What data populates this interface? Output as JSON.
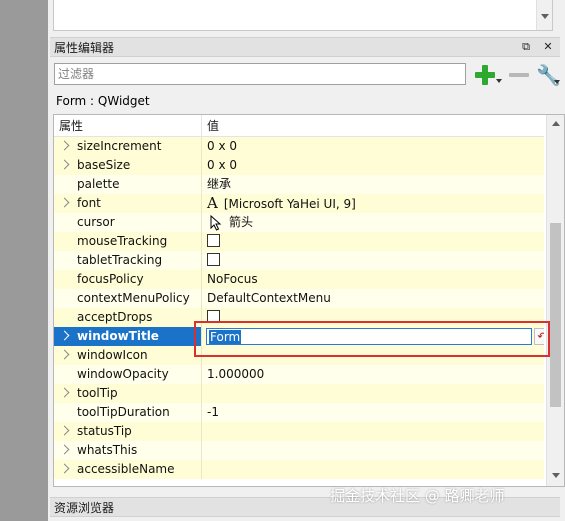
{
  "property_editor": {
    "title": "属性编辑器",
    "filter_placeholder": "过滤器",
    "class_label": "Form : QWidget",
    "columns": {
      "property": "属性",
      "value": "值"
    },
    "rows": [
      {
        "name": "sizeIncrement",
        "value": "0 x 0",
        "expandable": true,
        "kind": "text",
        "shade": "yellow"
      },
      {
        "name": "baseSize",
        "value": "0 x 0",
        "expandable": true,
        "kind": "text",
        "shade": "yellow"
      },
      {
        "name": "palette",
        "value": "继承",
        "expandable": false,
        "kind": "text",
        "shade": "white"
      },
      {
        "name": "font",
        "value": "[Microsoft YaHei UI, 9]",
        "expandable": true,
        "kind": "font",
        "shade": "yellow"
      },
      {
        "name": "cursor",
        "value": "箭头",
        "expandable": false,
        "kind": "cursor",
        "shade": "white"
      },
      {
        "name": "mouseTracking",
        "value": "",
        "expandable": false,
        "kind": "checkbox",
        "shade": "yellow"
      },
      {
        "name": "tabletTracking",
        "value": "",
        "expandable": false,
        "kind": "checkbox",
        "shade": "white"
      },
      {
        "name": "focusPolicy",
        "value": "NoFocus",
        "expandable": false,
        "kind": "text",
        "shade": "yellow"
      },
      {
        "name": "contextMenuPolicy",
        "value": "DefaultContextMenu",
        "expandable": false,
        "kind": "text",
        "shade": "white"
      },
      {
        "name": "acceptDrops",
        "value": "",
        "expandable": false,
        "kind": "checkbox",
        "shade": "yellow"
      },
      {
        "name": "windowTitle",
        "value": "Form",
        "expandable": true,
        "kind": "editing",
        "shade": "sel"
      },
      {
        "name": "windowIcon",
        "value": "",
        "expandable": true,
        "kind": "text",
        "shade": "yellow"
      },
      {
        "name": "windowOpacity",
        "value": "1.000000",
        "expandable": false,
        "kind": "text",
        "shade": "white"
      },
      {
        "name": "toolTip",
        "value": "",
        "expandable": true,
        "kind": "text",
        "shade": "yellow"
      },
      {
        "name": "toolTipDuration",
        "value": "-1",
        "expandable": false,
        "kind": "text",
        "shade": "white"
      },
      {
        "name": "statusTip",
        "value": "",
        "expandable": true,
        "kind": "text",
        "shade": "yellow"
      },
      {
        "name": "whatsThis",
        "value": "",
        "expandable": true,
        "kind": "text",
        "shade": "white"
      },
      {
        "name": "accessibleName",
        "value": "",
        "expandable": true,
        "kind": "text",
        "shade": "yellow"
      }
    ]
  },
  "resource_browser": {
    "title": "资源浏览器"
  },
  "watermark": "掘金技术社区 @ 路卿老师",
  "colors": {
    "selection": "#1a73c9",
    "highlight_border": "#d9312d",
    "row_yellow": "#fffdd5"
  }
}
